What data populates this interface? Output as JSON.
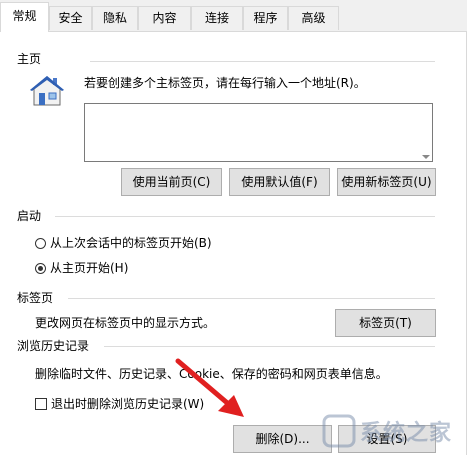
{
  "tabs": [
    {
      "label": "常规",
      "active": true
    },
    {
      "label": "安全"
    },
    {
      "label": "隐私"
    },
    {
      "label": "内容"
    },
    {
      "label": "连接"
    },
    {
      "label": "程序"
    },
    {
      "label": "高级"
    }
  ],
  "homepage": {
    "title": "主页",
    "description": "若要创建多个主标签页，请在每行输入一个地址(R)。",
    "address_value": "",
    "buttons": {
      "use_current": "使用当前页(C)",
      "use_default": "使用默认值(F)",
      "use_new_tab": "使用新标签页(U)"
    },
    "icon": "house-icon"
  },
  "startup": {
    "title": "启动",
    "options": [
      {
        "label": "从上次会话中的标签页开始(B)",
        "selected": false
      },
      {
        "label": "从主页开始(H)",
        "selected": true
      }
    ]
  },
  "tabs_section": {
    "title": "标签页",
    "description": "更改网页在标签页中的显示方式。",
    "button": "标签页(T)"
  },
  "history": {
    "title": "浏览历史记录",
    "description": "删除临时文件、历史记录、Cookie、保存的密码和网页表单信息。",
    "checkbox_label": "退出时删除浏览历史记录(W)",
    "checkbox_checked": false,
    "delete_button": "删除(D)...",
    "settings_button": "设置(S)"
  },
  "annotation": {
    "arrow_color": "#e02020"
  },
  "watermark": {
    "text": "系统之家"
  }
}
